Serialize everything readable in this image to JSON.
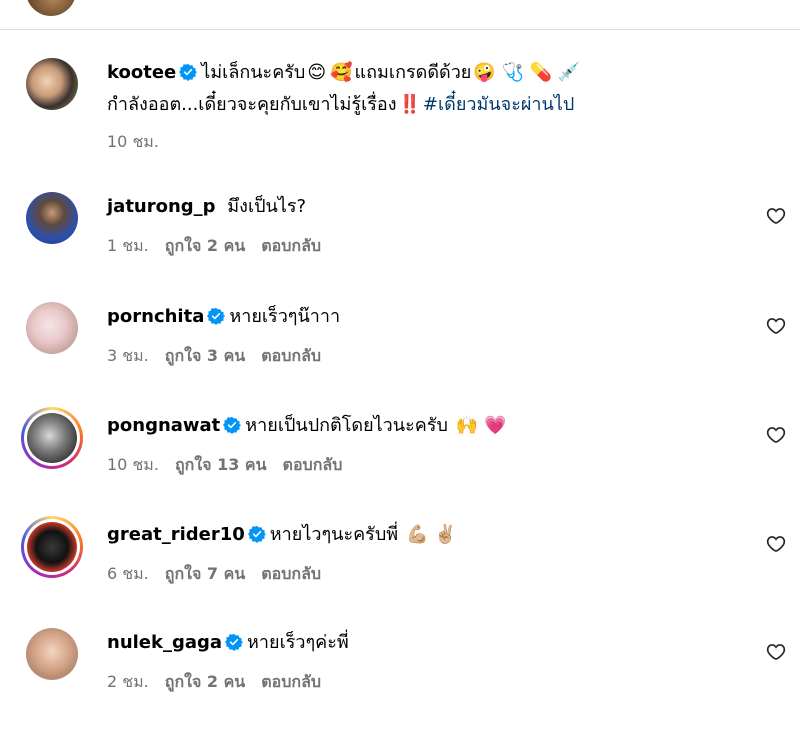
{
  "comments": [
    {
      "username": "kootee",
      "verified": true,
      "text_line1": "ไม่เล็กนะครับ",
      "text_line1_tail": "แถมเกรดดีด้วย",
      "text_line2": "กำลังออต...เดี๋ยวจะคุยกับเขาไม่รู้เรื่อง",
      "hashtag": "#เดี๋ยวมันจะผ่านไป",
      "emojis_1": "😊",
      "emojis_2": "🥰",
      "emojis_3": "🤪 🩺 💊 💉",
      "emoji_2b": "‼️",
      "time": "10 ชม."
    },
    {
      "username": "jaturong_p",
      "verified": false,
      "text": "มึงเป็นไร?",
      "time": "1 ชม.",
      "likes": "ถูกใจ 2 คน",
      "reply": "ตอบกลับ"
    },
    {
      "username": "pornchita",
      "verified": true,
      "text": "หายเร็วๆน๊าาา",
      "time": "3 ชม.",
      "likes": "ถูกใจ 3 คน",
      "reply": "ตอบกลับ"
    },
    {
      "username": "pongnawat",
      "verified": true,
      "text": "หายเป็นปกติโดยไวนะครับ",
      "emojis": "🙌 💗",
      "time": "10 ชม.",
      "likes": "ถูกใจ 13 คน",
      "reply": "ตอบกลับ"
    },
    {
      "username": "great_rider10",
      "verified": true,
      "text": "หายไวๆนะครับพี่",
      "emojis": "💪🏼 ✌🏼",
      "time": "6 ชม.",
      "likes": "ถูกใจ 7 คน",
      "reply": "ตอบกลับ"
    },
    {
      "username": "nulek_gaga",
      "verified": true,
      "text": "หายเร็วๆค่ะพี่",
      "time": "2 ชม.",
      "likes": "ถูกใจ 2 คน",
      "reply": "ตอบกลับ"
    }
  ],
  "colors": {
    "verified": "#0095f6",
    "hashtag": "#00376b",
    "meta": "#737373",
    "divider": "#dbdbdb"
  },
  "icons": {
    "like": "heart-outline-icon",
    "verified": "verified-badge-icon"
  }
}
